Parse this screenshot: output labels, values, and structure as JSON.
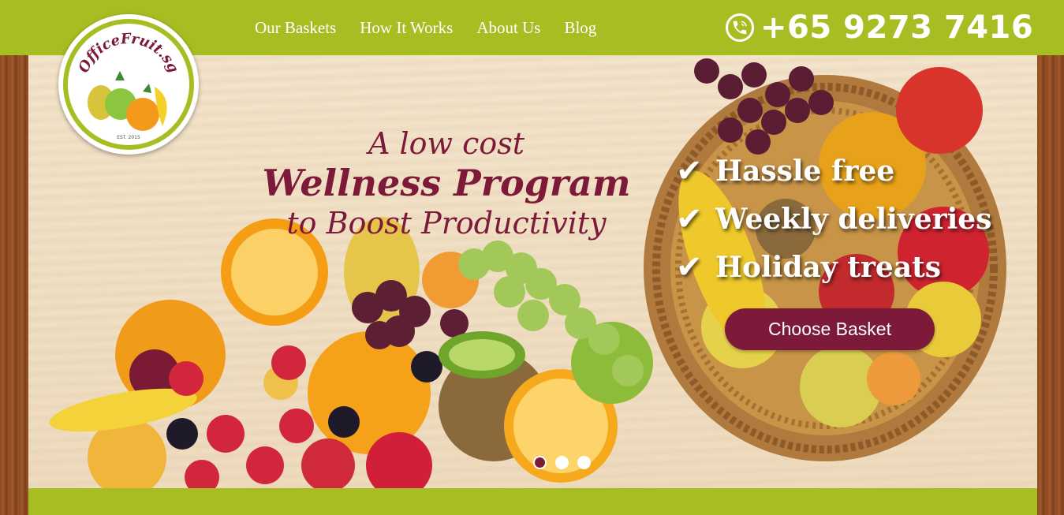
{
  "nav": {
    "items": [
      {
        "label": "Our Baskets"
      },
      {
        "label": "How It Works"
      },
      {
        "label": "About Us"
      },
      {
        "label": "Blog"
      }
    ]
  },
  "header": {
    "phone": "+65 9273 7416",
    "phone_icon": "phone-icon"
  },
  "logo": {
    "brand": "OfficeFruit.sg",
    "est": "EST. 2015"
  },
  "hero": {
    "line1": "A low cost",
    "line2": "Wellness Program",
    "line3": "to Boost Productivity",
    "features": [
      {
        "icon": "checkmark-icon",
        "text": "Hassle free"
      },
      {
        "icon": "checkmark-icon",
        "text": "Weekly deliveries"
      },
      {
        "icon": "checkmark-icon",
        "text": "Holiday treats"
      }
    ],
    "cta_label": "Choose Basket"
  },
  "slider": {
    "slide_count": 3,
    "active_index": 0
  },
  "colors": {
    "brand_green": "#a7bd22",
    "brand_maroon": "#7d1a3a",
    "wood": "#8a4a22"
  }
}
